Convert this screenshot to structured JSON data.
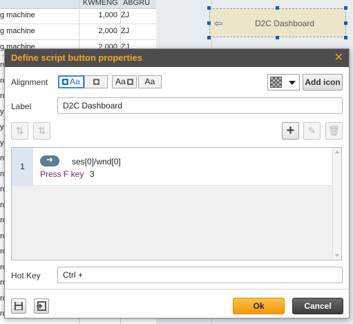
{
  "background": {
    "columns": [
      "KWMENG",
      "ABGRU"
    ],
    "rows": [
      {
        "text": "g machine",
        "qty": "1,000",
        "code": "ZJ"
      },
      {
        "text": "g machine",
        "qty": "2,000",
        "code": "ZJ"
      },
      {
        "text": "g machine",
        "qty": "2,000",
        "code": "ZJ"
      }
    ],
    "side_letters": [
      "ro",
      "ro",
      "ro",
      "y",
      "y",
      "y",
      "ro",
      "ro",
      "ro",
      "ro",
      "ro",
      "ro",
      "ro",
      "ro",
      "ro",
      "ro",
      "ro"
    ],
    "canvas_button_label": "D2C Dashboard"
  },
  "dialog": {
    "title": "Define script button properties",
    "alignment_label": "Alignment",
    "alignment_options": [
      "Aa",
      "",
      "Aa",
      "Aa"
    ],
    "add_icon_label": "Add icon",
    "label_caption": "Label",
    "label_value": "D2C Dashboard",
    "script": {
      "line_number": "1",
      "target": "ses[0]/wnd[0]",
      "action": "Press F key",
      "value": "3"
    },
    "hotkey_caption": "Hot Key",
    "hotkey_value": "Ctrl +",
    "ok_label": "Ok",
    "cancel_label": "Cancel"
  },
  "colors": {
    "title_text": "#f5a623",
    "titlebar_bg": "#4d4d4d",
    "ok_bg": "#f5a623",
    "cancel_bg": "#4a4a4a",
    "selected_border": "#2a8ad6",
    "action_text": "#7a1f6e"
  }
}
